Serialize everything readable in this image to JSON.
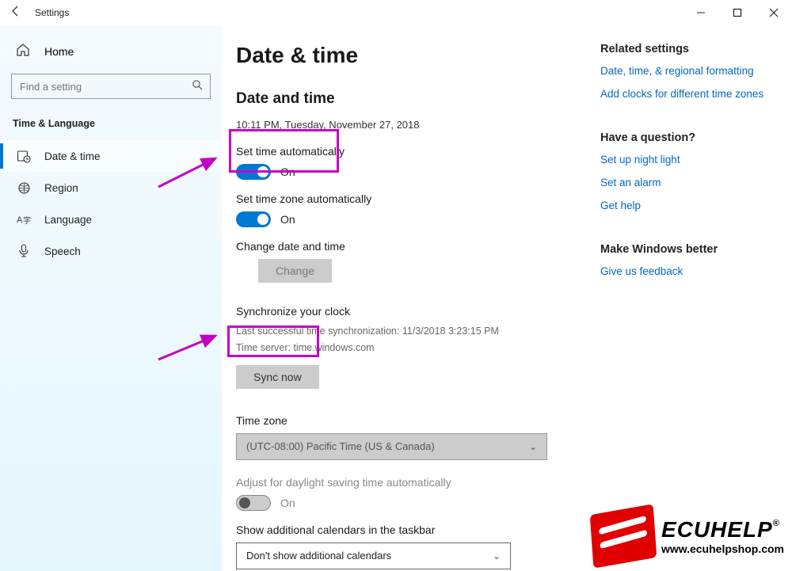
{
  "window": {
    "title": "Settings"
  },
  "sidebar": {
    "home": "Home",
    "search_placeholder": "Find a setting",
    "category": "Time & Language",
    "items": [
      {
        "label": "Date & time"
      },
      {
        "label": "Region"
      },
      {
        "label": "Language"
      },
      {
        "label": "Speech"
      }
    ]
  },
  "page": {
    "title": "Date & time",
    "section_heading": "Date and time",
    "current_time": "10:11 PM, Tuesday, November 27, 2018",
    "set_time_auto_label": "Set time automatically",
    "set_time_auto_state": "On",
    "set_tz_auto_label": "Set time zone automatically",
    "set_tz_auto_state": "On",
    "change_dt_label": "Change date and time",
    "change_btn": "Change",
    "sync_heading": "Synchronize your clock",
    "sync_last": "Last successful time synchronization: 11/3/2018 3:23:15 PM",
    "sync_server": "Time server: time.windows.com",
    "sync_btn": "Sync now",
    "tz_label": "Time zone",
    "tz_value": "(UTC-08:00) Pacific Time (US & Canada)",
    "dst_label": "Adjust for daylight saving time automatically",
    "dst_state": "On",
    "cal_label": "Show additional calendars in the taskbar",
    "cal_value": "Don't show additional calendars"
  },
  "right": {
    "related_heading": "Related settings",
    "related_links": [
      "Date, time, & regional formatting",
      "Add clocks for different time zones"
    ],
    "question_heading": "Have a question?",
    "question_links": [
      "Set up night light",
      "Set an alarm",
      "Get help"
    ],
    "better_heading": "Make Windows better",
    "better_links": [
      "Give us feedback"
    ]
  },
  "watermark": {
    "brand": "ECUHELP",
    "reg": "®",
    "url": "www.ecuhelpshop.com"
  }
}
